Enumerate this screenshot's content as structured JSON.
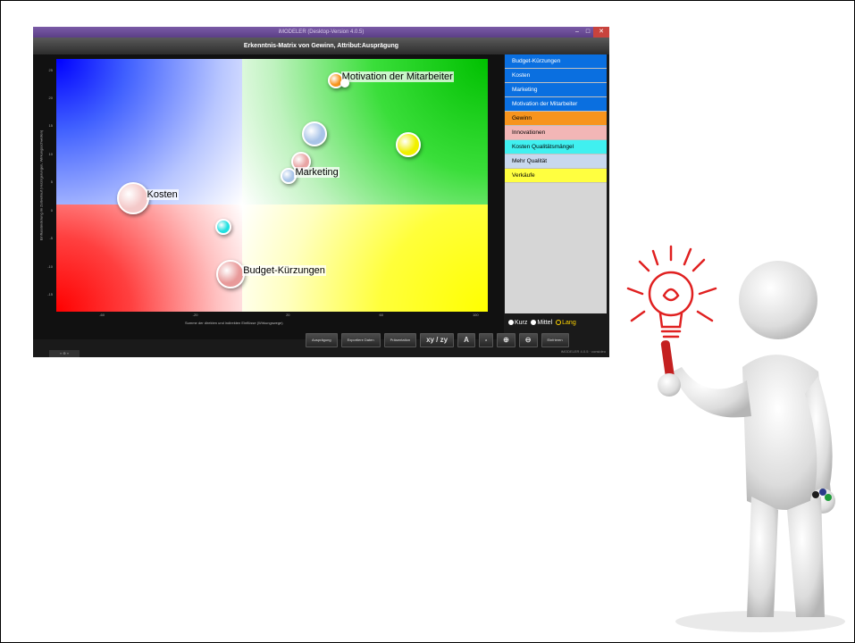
{
  "window": {
    "title": "iMODELER (Desktop-Version 4.0.5)",
    "header": "Erkenntnis-Matrix von Gewinn, Attribut:Ausprägung",
    "minimize": "–",
    "maximize": "□",
    "close": "✕"
  },
  "chart_data": {
    "type": "scatter",
    "title": "Erkenntnis-Matrix von Gewinn, Attribut:Ausprägung",
    "xlabel": "Summe der direkten und indirekten Einflüsse (Wirkungswege)",
    "ylabel": "Einflussänderung im Zeitverlauf (Verzögerungen, Wirkungsschwellen)",
    "xlim": [
      -80,
      105
    ],
    "ylim": [
      -18,
      27
    ],
    "x_ticks": [
      "-60",
      "-20",
      "20",
      "60",
      "100"
    ],
    "y_ticks": [
      "25",
      "20",
      "15",
      "10",
      "5",
      "0",
      "-5",
      "-10",
      "-15"
    ],
    "grid": false,
    "points": [
      {
        "label": "Motivation der Mitarbeiter",
        "x": 39,
        "y": 23.5,
        "color": "#f7941d",
        "r": 7
      },
      {
        "label": "",
        "x": 43,
        "y": 23,
        "color": "#ffffff",
        "r": 3
      },
      {
        "label": "",
        "x": 30,
        "y": 14,
        "color": "#a9c4e8",
        "r": 12
      },
      {
        "label": "",
        "x": 70,
        "y": 12,
        "color": "#f0f000",
        "r": 12
      },
      {
        "label": "",
        "x": 24,
        "y": 9,
        "color": "#e8a4a4",
        "r": 9
      },
      {
        "label": "Marketing",
        "x": 19,
        "y": 6.5,
        "color": "#a9c4e8",
        "r": 7
      },
      {
        "label": "Kosten",
        "x": -48,
        "y": 2.5,
        "color": "#f4c9c9",
        "r": 16
      },
      {
        "label": "",
        "x": -9,
        "y": -2.5,
        "color": "#20e0e0",
        "r": 7
      },
      {
        "label": "Budget-Kürzungen",
        "x": -6,
        "y": -11,
        "color": "#e89a9a",
        "r": 14
      }
    ]
  },
  "legend": [
    {
      "label": "Budget-Kürzungen",
      "bg": "#0a6fe0",
      "fg": "#ffffff"
    },
    {
      "label": "Kosten",
      "bg": "#0a6fe0",
      "fg": "#ffffff"
    },
    {
      "label": "Marketing",
      "bg": "#0a6fe0",
      "fg": "#ffffff"
    },
    {
      "label": "Motivation der Mitarbeiter",
      "bg": "#0a6fe0",
      "fg": "#ffffff"
    },
    {
      "label": "Gewinn",
      "bg": "#f7941d",
      "fg": "#000000"
    },
    {
      "label": "Innovationen",
      "bg": "#f2b6b6",
      "fg": "#000000"
    },
    {
      "label": "Kosten Qualitätsmängel",
      "bg": "#40f0f0",
      "fg": "#000000"
    },
    {
      "label": "Mehr Qualität",
      "bg": "#c8d8ee",
      "fg": "#000000"
    },
    {
      "label": "Verkäufe",
      "bg": "#ffff40",
      "fg": "#000000"
    }
  ],
  "radios": [
    {
      "label": "Kurz",
      "selected": false
    },
    {
      "label": "Mittel",
      "selected": false
    },
    {
      "label": "Lang",
      "selected": true
    }
  ],
  "toolbar": [
    {
      "label": "Ausprägung",
      "big": false
    },
    {
      "label": "Exportiere Daten",
      "big": false
    },
    {
      "label": "Präsentation",
      "big": false
    },
    {
      "label": "xy / zy",
      "big": true
    },
    {
      "label": "A",
      "big": true
    },
    {
      "label": "a",
      "big": false
    },
    {
      "label": "⊕",
      "big": true
    },
    {
      "label": "⊖",
      "big": true
    },
    {
      "label": "Einfrieren",
      "big": false
    }
  ],
  "status": {
    "left": "« ⊕ »",
    "right": "iMODELER 4.0.5 · consideo"
  },
  "figure": {
    "icon": "lightbulb-icon"
  }
}
